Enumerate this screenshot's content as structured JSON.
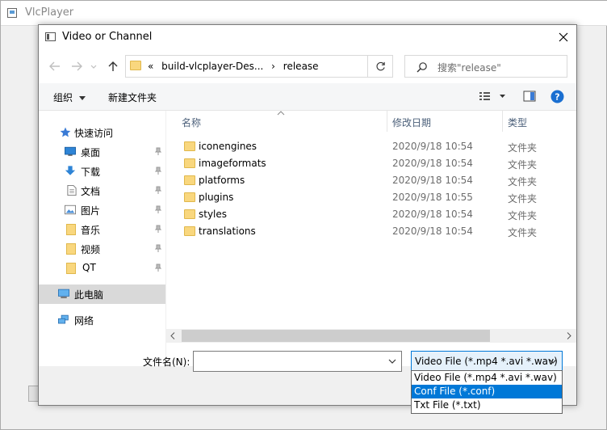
{
  "parent_window": {
    "title": "VlcPlayer"
  },
  "dialog": {
    "title": "Video or Channel",
    "address": {
      "breadcrumb_overflow": "«",
      "crumbs": [
        "build-vlcplayer-Des...",
        "release"
      ]
    },
    "search_placeholder": "搜索\"release\"",
    "toolbar": {
      "organize": "组织",
      "new_folder": "新建文件夹"
    },
    "nav": {
      "quick_access": "快速访问",
      "items": [
        {
          "label": "桌面",
          "icon": "desktop-icon"
        },
        {
          "label": "下载",
          "icon": "download-icon"
        },
        {
          "label": "文档",
          "icon": "document-icon"
        },
        {
          "label": "图片",
          "icon": "picture-icon"
        },
        {
          "label": "音乐",
          "icon": "folder-icon"
        },
        {
          "label": "视频",
          "icon": "folder-icon"
        },
        {
          "label": "QT",
          "icon": "folder-icon"
        }
      ],
      "this_pc": "此电脑",
      "network": "网络"
    },
    "columns": {
      "name": "名称",
      "date": "修改日期",
      "type": "类型"
    },
    "files": [
      {
        "name": "iconengines",
        "date": "2020/9/18 10:54",
        "type": "文件夹"
      },
      {
        "name": "imageformats",
        "date": "2020/9/18 10:54",
        "type": "文件夹"
      },
      {
        "name": "platforms",
        "date": "2020/9/18 10:54",
        "type": "文件夹"
      },
      {
        "name": "plugins",
        "date": "2020/9/18 10:55",
        "type": "文件夹"
      },
      {
        "name": "styles",
        "date": "2020/9/18 10:54",
        "type": "文件夹"
      },
      {
        "name": "translations",
        "date": "2020/9/18 10:54",
        "type": "文件夹"
      }
    ],
    "filename_label": "文件名(N):",
    "filename_value": "",
    "filetype_selected": "Video File (*.mp4 *.avi *.wav)",
    "filetype_options": [
      "Video File (*.mp4 *.avi *.wav)",
      "Conf File (*.conf)",
      "Txt File (*.txt)"
    ],
    "filetype_highlighted_index": 1
  },
  "colors": {
    "accent": "#0078d7",
    "folder": "#f9d77e"
  }
}
